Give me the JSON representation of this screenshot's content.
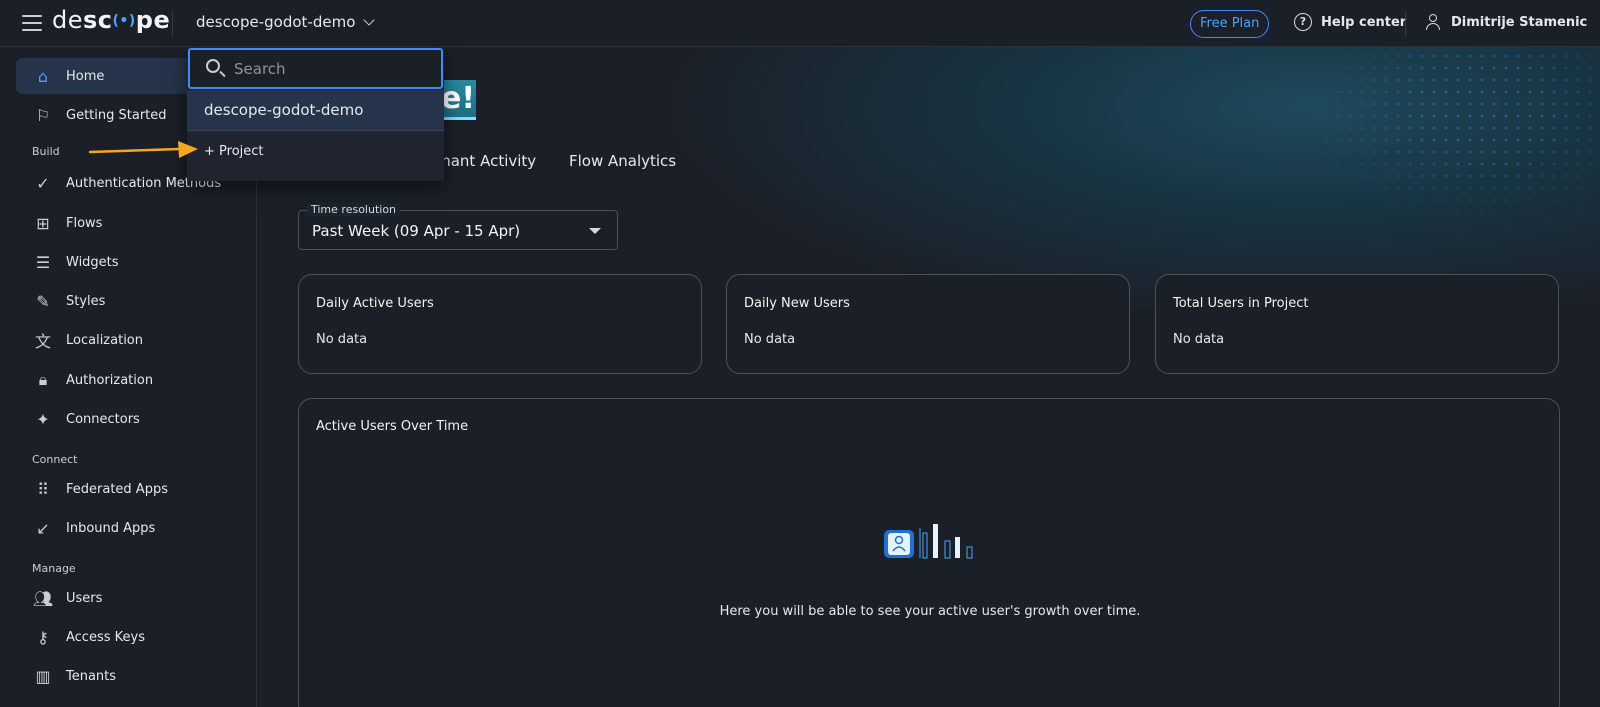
{
  "topbar": {
    "logo": {
      "part1": "de",
      "part2": "sc",
      "paren": "(•)",
      "part3": "pe"
    },
    "project": "descope-godot-demo",
    "free_plan": "Free Plan",
    "help_center": "Help center",
    "help_icon": "?",
    "user_name": "Dimitrije Stamenic"
  },
  "sidebar": {
    "home": {
      "label": "Home",
      "icon": "⌂"
    },
    "getting_started": {
      "label": "Getting Started",
      "icon": "⚐"
    },
    "section_build": "Build",
    "auth_methods": {
      "label": "Authentication Methods",
      "icon": "✓"
    },
    "flows": {
      "label": "Flows",
      "icon": "⊞"
    },
    "widgets": {
      "label": "Widgets",
      "icon": "☰"
    },
    "styles": {
      "label": "Styles",
      "icon": "✎"
    },
    "localization": {
      "label": "Localization",
      "icon": "文"
    },
    "authorization": {
      "label": "Authorization",
      "icon": "🔒︎"
    },
    "connectors": {
      "label": "Connectors",
      "icon": "✦"
    },
    "section_connect": "Connect",
    "federated_apps": {
      "label": "Federated Apps",
      "icon": "⠿"
    },
    "inbound_apps": {
      "label": "Inbound Apps",
      "icon": "↙"
    },
    "section_manage": "Manage",
    "users": {
      "label": "Users",
      "icon": "👥︎"
    },
    "access_keys": {
      "label": "Access Keys",
      "icon": "⚷"
    },
    "tenants": {
      "label": "Tenants",
      "icon": "▥"
    }
  },
  "main": {
    "welcome_fragment": "e!",
    "tabs": {
      "tenant_activity": "enant Activity",
      "flow_analytics": "Flow Analytics"
    },
    "time_resolution": {
      "legend": "Time resolution",
      "value": "Past Week (09 Apr - 15 Apr)"
    },
    "cards": [
      {
        "title": "Daily Active Users",
        "value": "No data"
      },
      {
        "title": "Daily New Users",
        "value": "No data"
      },
      {
        "title": "Total Users in Project",
        "value": "No data"
      }
    ],
    "active_users": {
      "title": "Active Users Over Time",
      "empty_text": "Here you will be able to see your active user's growth over time."
    }
  },
  "dropdown": {
    "search_placeholder": "Search",
    "search_value": "",
    "option": "descope-godot-demo",
    "add_project": "+ Project"
  },
  "colors": {
    "accent": "#3d8bff",
    "annotation_arrow": "#f5a623"
  }
}
